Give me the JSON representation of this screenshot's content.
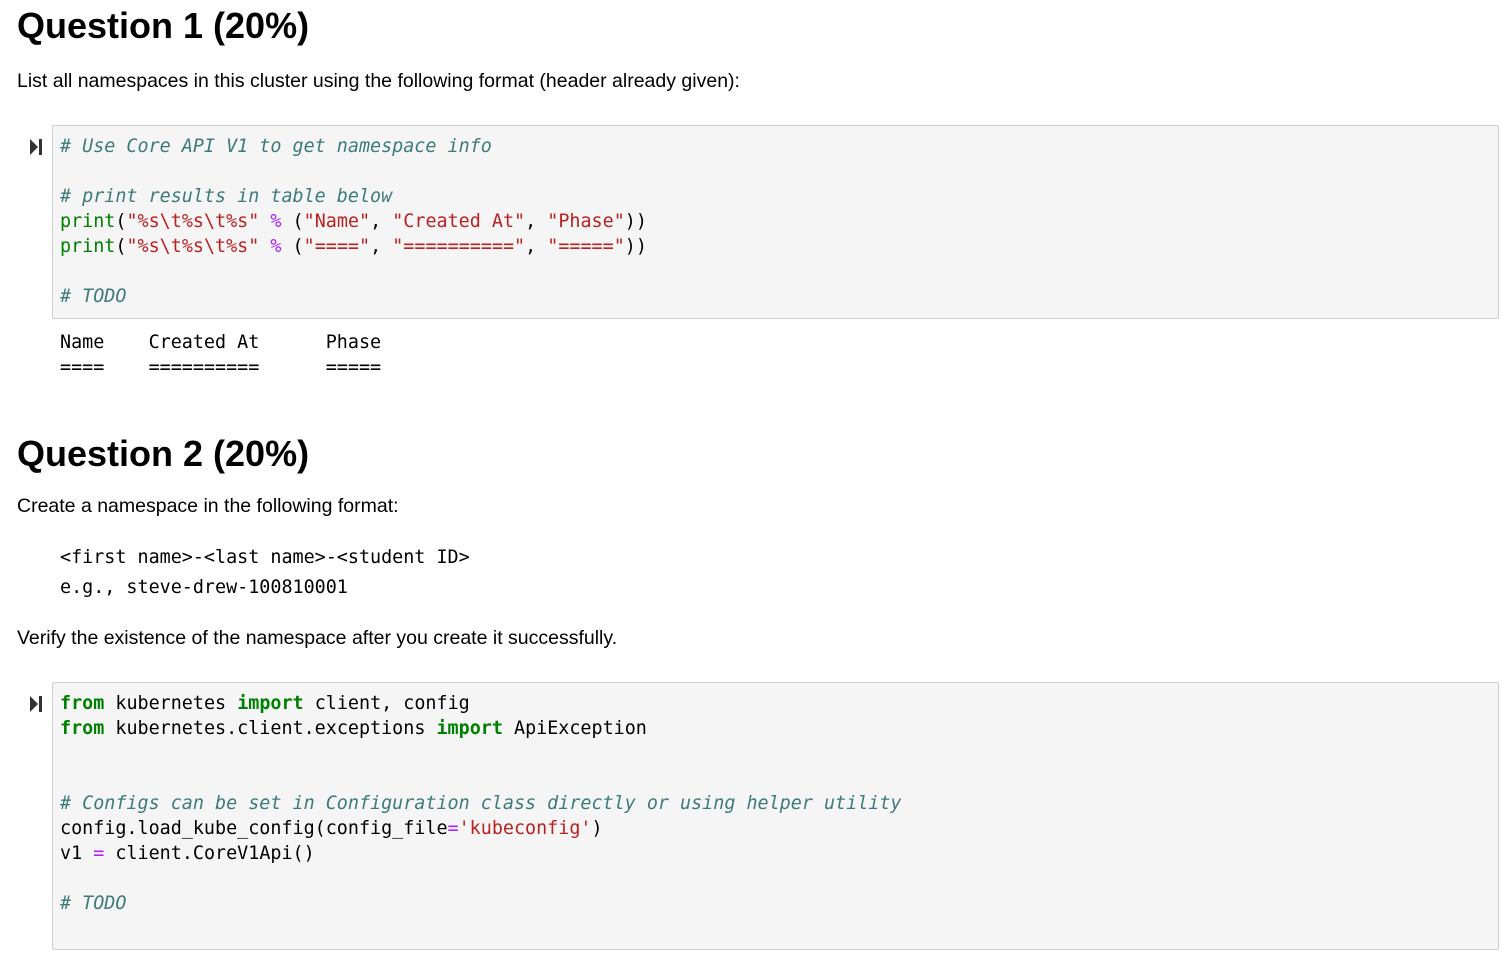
{
  "q1": {
    "title": "Question 1 (20%)",
    "description": "List all namespaces in this cluster using the following format (header already given):",
    "code": {
      "comment1": "# Use Core API V1 to get namespace info",
      "comment2": "# print results in table below",
      "print_fn": "print",
      "fmt": "\"%s\\t%s\\t%s\"",
      "pct": "%",
      "h_name": "\"Name\"",
      "h_created": "\"Created At\"",
      "h_phase": "\"Phase\"",
      "u_name": "\"====\"",
      "u_created": "\"==========\"",
      "u_phase": "\"=====\"",
      "todo": "# TODO"
    },
    "output": {
      "line1": "Name    Created At      Phase",
      "line2": "====    ==========      ====="
    }
  },
  "q2": {
    "title": "Question 2 (20%)",
    "description": "Create a namespace in the following format:",
    "format_line": "<first name>-<last name>-<student ID>",
    "example_line": "e.g., steve-drew-100810001",
    "verify_text": "Verify the existence of the namespace after you create it successfully.",
    "code": {
      "kw_from": "from",
      "kw_import": "import",
      "mod1": "kubernetes",
      "names1": "client, config",
      "mod2": "kubernetes.client.exceptions",
      "names2": "ApiException",
      "comment": "# Configs can be set in Configuration class directly or using helper utility",
      "load_prefix": "config.load_kube_config(config_file",
      "eq": "=",
      "kubeconfig": "'kubeconfig'",
      "close_paren": ")",
      "v1": "v1",
      "corev1": "client.CoreV1Api()",
      "todo": "# TODO"
    }
  }
}
